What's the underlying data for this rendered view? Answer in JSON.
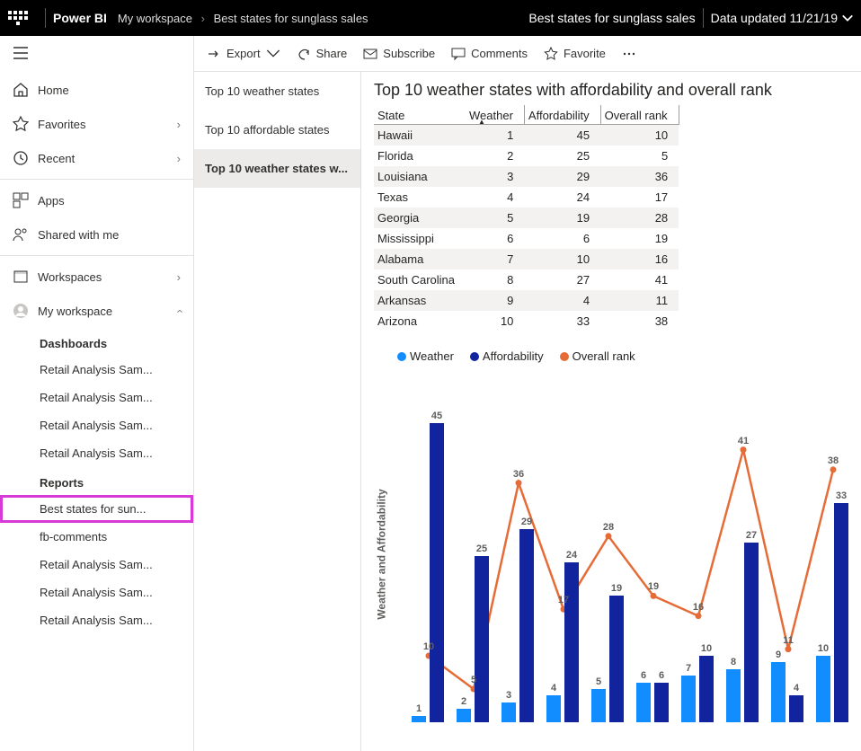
{
  "topbar": {
    "brand": "Power BI",
    "breadcrumb": [
      "My workspace",
      "Best states for sunglass sales"
    ],
    "report_title": "Best states for sunglass sales",
    "data_updated": "Data updated 11/21/19"
  },
  "leftnav": {
    "home": "Home",
    "favorites": "Favorites",
    "recent": "Recent",
    "apps": "Apps",
    "shared": "Shared with me",
    "workspaces": "Workspaces",
    "my_workspace": "My workspace",
    "dashboards_hdr": "Dashboards",
    "dashboards": [
      "Retail Analysis Sam...",
      "Retail Analysis Sam...",
      "Retail Analysis Sam...",
      "Retail Analysis Sam..."
    ],
    "reports_hdr": "Reports",
    "reports": [
      "Best states for sun...",
      "fb-comments",
      "Retail Analysis Sam...",
      "Retail Analysis Sam...",
      "Retail Analysis Sam..."
    ]
  },
  "toolbar": {
    "export": "Export",
    "share": "Share",
    "subscribe": "Subscribe",
    "comments": "Comments",
    "favorite": "Favorite"
  },
  "report_pages": {
    "tabs": [
      "Top 10 weather states",
      "Top 10 affordable states",
      "Top 10 weather states w..."
    ],
    "selected_index": 2
  },
  "table": {
    "title": "Top 10 weather states with affordability and overall rank",
    "columns": [
      "State",
      "Weather",
      "Affordability",
      "Overall rank"
    ],
    "sorted_col_index": 1,
    "rows": [
      {
        "state": "Hawaii",
        "weather": 1,
        "affordability": 45,
        "overall": 10
      },
      {
        "state": "Florida",
        "weather": 2,
        "affordability": 25,
        "overall": 5
      },
      {
        "state": "Louisiana",
        "weather": 3,
        "affordability": 29,
        "overall": 36
      },
      {
        "state": "Texas",
        "weather": 4,
        "affordability": 24,
        "overall": 17
      },
      {
        "state": "Georgia",
        "weather": 5,
        "affordability": 19,
        "overall": 28
      },
      {
        "state": "Mississippi",
        "weather": 6,
        "affordability": 6,
        "overall": 19
      },
      {
        "state": "Alabama",
        "weather": 7,
        "affordability": 10,
        "overall": 16
      },
      {
        "state": "South Carolina",
        "weather": 8,
        "affordability": 27,
        "overall": 41
      },
      {
        "state": "Arkansas",
        "weather": 9,
        "affordability": 4,
        "overall": 11
      },
      {
        "state": "Arizona",
        "weather": 10,
        "affordability": 33,
        "overall": 38
      }
    ]
  },
  "chart_data": {
    "type": "bar+line",
    "ylabel": "Weather and Affordability",
    "legend": [
      "Weather",
      "Affordability",
      "Overall rank"
    ],
    "colors": {
      "weather": "#118dff",
      "affordability": "#12239e",
      "overall": "#e66c37"
    },
    "categories": [
      "Hawaii",
      "Florida",
      "Louisiana",
      "Texas",
      "Georgia",
      "Mississippi",
      "Alabama",
      "South Carolina",
      "Arkansas",
      "Arizona"
    ],
    "series": [
      {
        "name": "Weather",
        "type": "bar",
        "values": [
          1,
          2,
          3,
          4,
          5,
          6,
          7,
          8,
          9,
          10
        ]
      },
      {
        "name": "Affordability",
        "type": "bar",
        "values": [
          45,
          25,
          29,
          24,
          19,
          6,
          10,
          27,
          4,
          33
        ]
      },
      {
        "name": "Overall rank",
        "type": "line",
        "values": [
          10,
          5,
          36,
          17,
          28,
          19,
          16,
          41,
          11,
          38
        ]
      }
    ],
    "ylim": [
      0,
      50
    ]
  }
}
